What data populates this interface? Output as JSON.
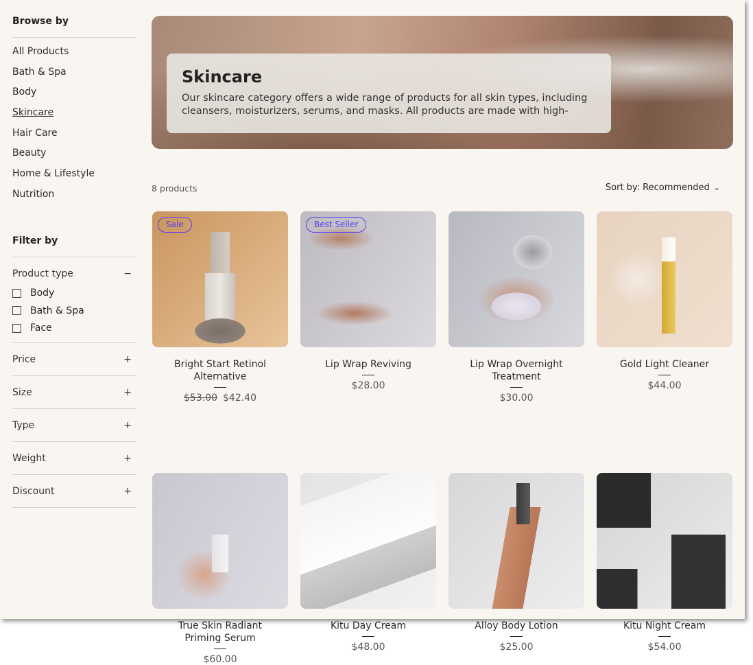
{
  "sidebar": {
    "browse_title": "Browse by",
    "categories": [
      "All Products",
      "Bath & Spa",
      "Body",
      "Skincare",
      "Hair Care",
      "Beauty",
      "Home & Lifestyle",
      "Nutrition"
    ],
    "active": "Skincare",
    "filter_title": "Filter by",
    "product_type": {
      "label": "Product type",
      "options": [
        "Body",
        "Bath & Spa",
        "Face"
      ]
    },
    "filters": [
      "Price",
      "Size",
      "Type",
      "Weight",
      "Discount"
    ]
  },
  "hero": {
    "title": "Skincare",
    "description": "Our skincare category offers a wide range of products for all skin types, including cleansers, moisturizers, serums, and masks. All products are made with high-quality,…"
  },
  "toolbar": {
    "count": "8 products",
    "sort": "Sort by: Recommended"
  },
  "colors": {
    "badge": "#5a3df0",
    "background": "#f9f6f2"
  },
  "products": [
    {
      "name": "Bright Start Retinol Alternative",
      "badge": "Sale",
      "old_price": "$53.00",
      "price": "$42.40"
    },
    {
      "name": "Lip Wrap Reviving",
      "badge": "Best Seller",
      "price": "$28.00"
    },
    {
      "name": "Lip Wrap Overnight Treatment",
      "price": "$30.00"
    },
    {
      "name": "Gold Light Cleaner",
      "price": "$44.00"
    },
    {
      "name": "True Skin Radiant Priming Serum",
      "price": "$60.00"
    },
    {
      "name": "Kitu Day Cream",
      "price": "$48.00"
    },
    {
      "name": "Alloy Body Lotion",
      "price": "$25.00"
    },
    {
      "name": "Kitu Night Cream",
      "price": "$54.00"
    }
  ]
}
